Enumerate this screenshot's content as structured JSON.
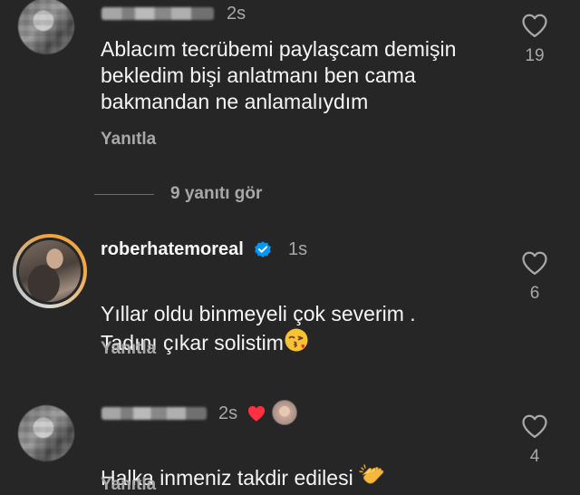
{
  "comments": [
    {
      "time": "2s",
      "text": "Ablacım tecrübemi paylaşcam demişin\nbekledim bişi anlatmanı ben cama\nbakmandan ne anlamalıydım",
      "reply_label": "Yanıtla",
      "likes": "19"
    },
    {
      "view_replies": "9 yanıtı gör"
    },
    {
      "username": "roberhatemoreal",
      "verified": true,
      "time": "1s",
      "text": "Yıllar oldu binmeyeli çok severim .\nTadını çıkar solistim",
      "emoji": "kissing-face-emoji",
      "reply_label": "Yanıtla",
      "likes": "6"
    },
    {
      "time": "2s",
      "liked_by_author": true,
      "text": "Halka inmeniz takdir edilesi ",
      "emoji": "clapping-hands-emoji",
      "reply_label": "Yanıtla",
      "likes": "4"
    }
  ],
  "colors": {
    "background": "#262626",
    "primary_text": "#f5f5f5",
    "secondary_text": "#a8a8a8",
    "verified_blue": "#0095f6",
    "liked_red": "#ff3040"
  }
}
